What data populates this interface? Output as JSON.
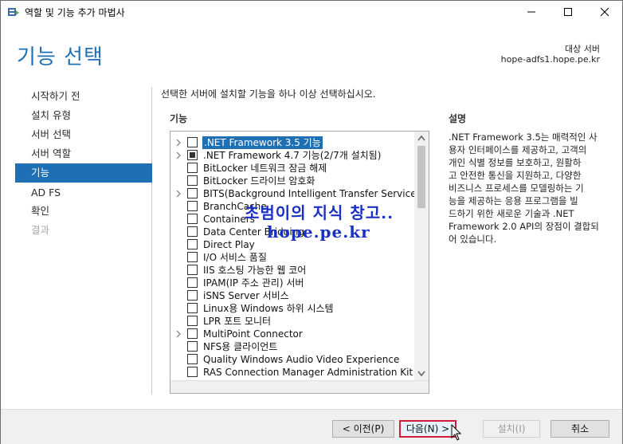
{
  "window": {
    "title": "역할 및 기능 추가 마법사"
  },
  "header": {
    "page_title": "기능 선택",
    "destination_label": "대상 서버",
    "destination_server": "hope-adfs1.hope.pe.kr"
  },
  "sidebar": {
    "items": [
      {
        "label": "시작하기 전",
        "state": "normal"
      },
      {
        "label": "설치 유형",
        "state": "normal"
      },
      {
        "label": "서버 선택",
        "state": "normal"
      },
      {
        "label": "서버 역할",
        "state": "normal"
      },
      {
        "label": "기능",
        "state": "active"
      },
      {
        "label": "AD FS",
        "state": "normal"
      },
      {
        "label": "확인",
        "state": "normal"
      },
      {
        "label": "결과",
        "state": "disabled"
      }
    ]
  },
  "main": {
    "instruction": "선택한 서버에 설치할 기능을 하나 이상 선택하십시오.",
    "features_label": "기능",
    "description_label": "설명",
    "features": [
      {
        "label": ".NET Framework 3.5 기능",
        "expandable": true,
        "checked": "none",
        "selected": true
      },
      {
        "label": ".NET Framework 4.7 기능(2/7개 설치됨)",
        "expandable": true,
        "checked": "partial",
        "selected": false
      },
      {
        "label": "BitLocker 네트워크 잠금 해제",
        "expandable": false,
        "checked": "none",
        "selected": false
      },
      {
        "label": "BitLocker 드라이브 암호화",
        "expandable": false,
        "checked": "none",
        "selected": false
      },
      {
        "label": "BITS(Background Intelligent Transfer Service)",
        "expandable": true,
        "checked": "none",
        "selected": false
      },
      {
        "label": "BranchCache",
        "expandable": false,
        "checked": "none",
        "selected": false
      },
      {
        "label": "Containers",
        "expandable": false,
        "checked": "none",
        "selected": false
      },
      {
        "label": "Data Center Bridging",
        "expandable": false,
        "checked": "none",
        "selected": false
      },
      {
        "label": "Direct Play",
        "expandable": false,
        "checked": "none",
        "selected": false
      },
      {
        "label": "I/O 서비스 품질",
        "expandable": false,
        "checked": "none",
        "selected": false
      },
      {
        "label": "IIS 호스팅 가능한 웹 코어",
        "expandable": false,
        "checked": "none",
        "selected": false
      },
      {
        "label": "IPAM(IP 주소 관리) 서버",
        "expandable": false,
        "checked": "none",
        "selected": false
      },
      {
        "label": "iSNS Server 서비스",
        "expandable": false,
        "checked": "none",
        "selected": false
      },
      {
        "label": "Linux용 Windows 하위 시스템",
        "expandable": false,
        "checked": "none",
        "selected": false
      },
      {
        "label": "LPR 포트 모니터",
        "expandable": false,
        "checked": "none",
        "selected": false
      },
      {
        "label": "MultiPoint Connector",
        "expandable": true,
        "checked": "none",
        "selected": false
      },
      {
        "label": "NFS용 클라이언트",
        "expandable": false,
        "checked": "none",
        "selected": false
      },
      {
        "label": "Quality Windows Audio Video Experience",
        "expandable": false,
        "checked": "none",
        "selected": false
      },
      {
        "label": "RAS Connection Manager Administration Kit (CM",
        "expandable": false,
        "checked": "none",
        "selected": false
      }
    ],
    "description_lines": [
      ".NET Framework 3.5는 매력적인 사",
      "용자 인터페이스를 제공하고, 고객의",
      "개인 식별 정보를 보호하고, 원활하",
      "고 안전한 통신을 지원하고, 다양한",
      "비즈니스 프로세스를 모델링하는 기",
      "능을 제공하는 응용 프로그램을 빌",
      "드하기 위한 새로운 기술과 .NET",
      "Framework 2.0 API의 장점이 결합되",
      "어 있습니다."
    ]
  },
  "watermark": {
    "line1": "초범이의 지식 창고..",
    "line2": "hope.pe.kr"
  },
  "footer": {
    "prev_label": "< 이전(P)",
    "next_label": "다음(N) >",
    "install_label": "설치(I)",
    "cancel_label": "취소"
  },
  "colors": {
    "accent": "#1f6fb5",
    "highlight_border": "#d21a3a",
    "watermark": "#1a2fc4"
  }
}
